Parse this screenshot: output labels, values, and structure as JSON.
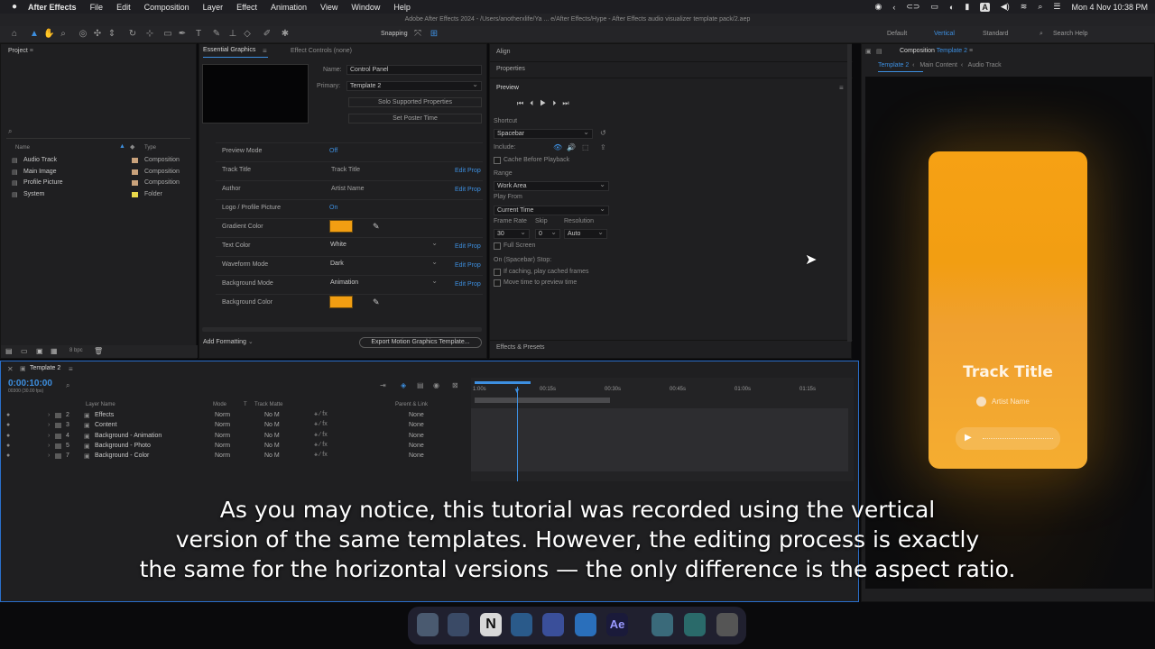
{
  "menubar": {
    "apple": "",
    "app_name": "After Effects",
    "items": [
      "File",
      "Edit",
      "Composition",
      "Layer",
      "Effect",
      "Animation",
      "View",
      "Window",
      "Help"
    ],
    "clock": "Mon 4 Nov  10:38 PM",
    "input_letter": "A"
  },
  "title": "Adobe After Effects 2024 - /Users/anotherxlife/Ya ... e/After Effects/Hype - After Effects audio visualizer template pack/2.aep",
  "toolbar": {
    "snapping_label": "Snapping",
    "workspaces": [
      "Default",
      "Vertical",
      "Standard"
    ],
    "search_placeholder": "Search Help"
  },
  "project": {
    "title": "Project",
    "cols": {
      "name": "Name",
      "type": "Type"
    },
    "items": [
      {
        "name": "Audio Track",
        "type": "Composition",
        "color": "#c9a27b"
      },
      {
        "name": "Main Image",
        "type": "Composition",
        "color": "#c9a27b"
      },
      {
        "name": "Profile Picture",
        "type": "Composition",
        "color": "#c9a27b"
      },
      {
        "name": "System",
        "type": "Folder",
        "color": "#e8d84a"
      }
    ],
    "bpc": "8 bpc"
  },
  "essential": {
    "tab1": "Essential Graphics",
    "tab2": "Effect Controls (none)",
    "name_label": "Name:",
    "name_value": "Control Panel",
    "primary_label": "Primary:",
    "primary_value": "Template 2",
    "solo_btn": "Solo Supported Properties",
    "poster_btn": "Set Poster Time",
    "props": [
      {
        "label": "Preview Mode",
        "value": "Off",
        "kind": "link"
      },
      {
        "label": "Track Title",
        "value": "Track Title",
        "kind": "text",
        "edit": "Edit Prop"
      },
      {
        "label": "Author",
        "value": "Artist Name",
        "kind": "text",
        "edit": "Edit Prop"
      },
      {
        "label": "Logo / Profile Picture",
        "value": "On",
        "kind": "link"
      },
      {
        "label": "Gradient Color",
        "value": "",
        "kind": "color"
      },
      {
        "label": "Text Color",
        "value": "White",
        "kind": "select",
        "edit": "Edit Prop"
      },
      {
        "label": "Waveform Mode",
        "value": "Dark",
        "kind": "select",
        "edit": "Edit Prop"
      },
      {
        "label": "Background Mode",
        "value": "Animation",
        "kind": "select",
        "edit": "Edit Prop"
      },
      {
        "label": "Background Color",
        "value": "",
        "kind": "color"
      }
    ],
    "add_formatting": "Add Formatting",
    "export_btn": "Export Motion Graphics Template..."
  },
  "right_panels": {
    "align": "Align",
    "properties": "Properties",
    "preview": "Preview",
    "shortcut_label": "Shortcut",
    "shortcut_value": "Spacebar",
    "include_label": "Include:",
    "cache_label": "Cache Before Playback",
    "range_label": "Range",
    "range_value": "Work Area",
    "playfrom_label": "Play From",
    "playfrom_value": "Current Time",
    "framerate_label": "Frame Rate",
    "skip_label": "Skip",
    "resolution_label": "Resolution",
    "framerate_value": "30",
    "skip_value": "0",
    "resolution_value": "Auto",
    "fullscreen_label": "Full Screen",
    "stop_label": "On (Spacebar) Stop:",
    "stop_opt1": "If caching, play cached frames",
    "stop_opt2": "Move time to preview time",
    "effects_presets": "Effects & Presets"
  },
  "composition": {
    "title_prefix": "Composition",
    "title_comp": "Template 2",
    "crumbs": [
      "Template 2",
      "Main Content",
      "Audio Track"
    ],
    "card": {
      "track_title": "Track Title",
      "artist": "Artist Name",
      "gradient_color": "#f29e12"
    }
  },
  "timeline": {
    "tab": "Template 2",
    "timecode": "0:00:10:00",
    "timecode_sub": "00300 (30.00 fps)",
    "cols": {
      "layer": "Layer Name",
      "mode": "Mode",
      "t": "T",
      "matte": "Track Matte",
      "parent": "Parent & Link"
    },
    "ruler": [
      "1:00s",
      "00:15s",
      "00:30s",
      "00:45s",
      "01:00s",
      "01:15s"
    ],
    "layers": [
      {
        "num": "2",
        "name": "Effects",
        "mode": "Norm",
        "matte": "No M",
        "parent": "None"
      },
      {
        "num": "3",
        "name": "Content",
        "mode": "Norm",
        "matte": "No M",
        "parent": "None"
      },
      {
        "num": "4",
        "name": "Background - Animation",
        "mode": "Norm",
        "matte": "No M",
        "parent": "None"
      },
      {
        "num": "5",
        "name": "Background - Photo",
        "mode": "Norm",
        "matte": "No M",
        "parent": "None"
      },
      {
        "num": "7",
        "name": "Background - Color",
        "mode": "Norm",
        "matte": "No M",
        "parent": "None"
      }
    ]
  },
  "caption": {
    "line1": "As you may notice, this tutorial was recorded using the vertical",
    "line2": "version of the same templates. However, the editing process is exactly",
    "line3": "the same for the horizontal versions — the only difference is the aspect ratio."
  },
  "colors": {
    "accent": "#3d8fe0",
    "orange": "#f29e12"
  }
}
